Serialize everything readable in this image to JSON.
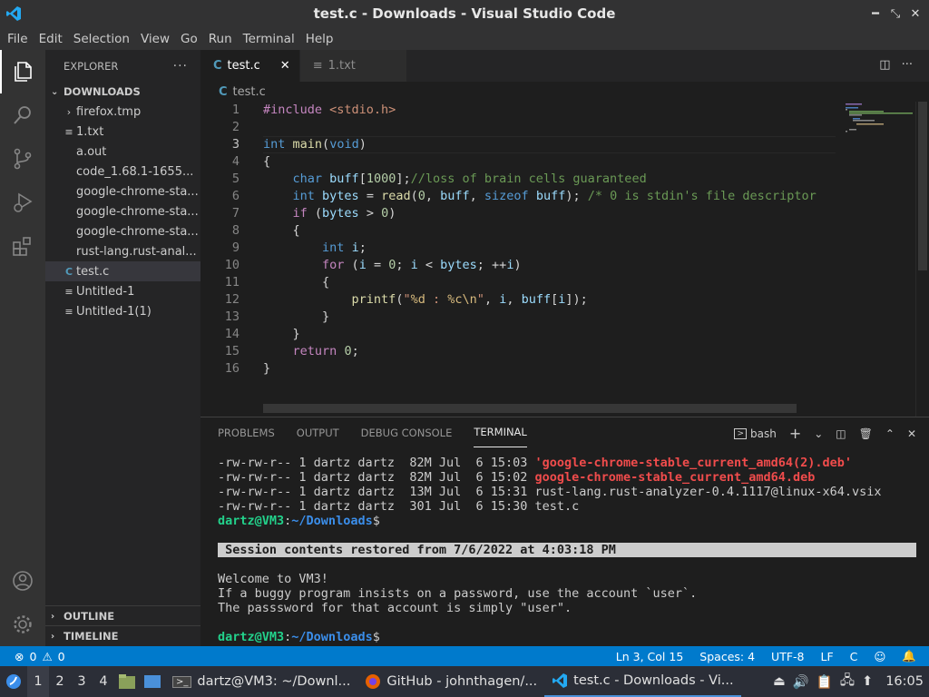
{
  "window": {
    "title": "test.c - Downloads - Visual Studio Code"
  },
  "menu": [
    "File",
    "Edit",
    "Selection",
    "View",
    "Go",
    "Run",
    "Terminal",
    "Help"
  ],
  "explorer": {
    "title": "EXPLORER",
    "folder": "DOWNLOADS",
    "items": [
      "firefox.tmp",
      "1.txt",
      "a.out",
      "code_1.68.1-1655...",
      "google-chrome-sta...",
      "google-chrome-sta...",
      "google-chrome-sta...",
      "rust-lang.rust-anal...",
      "test.c",
      "Untitled-1",
      "Untitled-1(1)"
    ],
    "outline": "OUTLINE",
    "timeline": "TIMELINE"
  },
  "tabs": [
    {
      "label": "test.c"
    },
    {
      "label": "1.txt"
    }
  ],
  "breadcrumb": "test.c",
  "line_numbers": [
    "1",
    "2",
    "3",
    "4",
    "5",
    "6",
    "7",
    "8",
    "9",
    "10",
    "11",
    "12",
    "13",
    "14",
    "15",
    "16"
  ],
  "code_lines": [
    "#include <stdio.h>",
    "",
    "int main(void)",
    "{",
    "    char buff[1000];//loss of brain cells guaranteed",
    "    int bytes = read(0, buff, sizeof buff); /* 0 is stdin's file descriptor",
    "    if (bytes > 0)",
    "    {",
    "        int i;",
    "        for (i = 0; i < bytes; ++i)",
    "        {",
    "            printf(\"%d : %c\\n\", i, buff[i]);",
    "        }",
    "    }",
    "    return 0;",
    "}"
  ],
  "panel": {
    "tabs": [
      "PROBLEMS",
      "OUTPUT",
      "DEBUG CONSOLE",
      "TERMINAL"
    ],
    "shell": "bash"
  },
  "terminal": {
    "files": [
      {
        "perm": "-rw-rw-r-- 1 dartz dartz  82M Jul  6 15:03 ",
        "name": "'google-chrome-stable_current_amd64(2).deb'",
        "color": "red"
      },
      {
        "perm": "-rw-rw-r-- 1 dartz dartz  82M Jul  6 15:02 ",
        "name": "google-chrome-stable_current_amd64.deb",
        "color": "red"
      },
      {
        "perm": "-rw-rw-r-- 1 dartz dartz  13M Jul  6 15:31 ",
        "name": "rust-lang.rust-analyzer-0.4.1117@linux-x64.vsix",
        "color": "plain"
      },
      {
        "perm": "-rw-rw-r-- 1 dartz dartz  301 Jul  6 15:30 ",
        "name": "test.c",
        "color": "plain"
      }
    ],
    "prompt_user": "dartz@VM3",
    "prompt_path": "~/Downloads",
    "prompt_sym": "$",
    "banner": " Session contents restored from 7/6/2022 at 4:03:18 PM",
    "welcome": [
      "Welcome to VM3!",
      "If a buggy program insists on a password, use the account `user`.",
      "The passsword for that account is simply \"user\"."
    ]
  },
  "status": {
    "errors": "0",
    "warnings": "0",
    "position": "Ln 3, Col 15",
    "spaces": "Spaces: 4",
    "encoding": "UTF-8",
    "eol": "LF",
    "language": "C"
  },
  "taskbar": {
    "workspaces": [
      "1",
      "2",
      "3",
      "4"
    ],
    "apps": [
      "dartz@VM3: ~/Downl...",
      "GitHub - johnthagen/...",
      "test.c - Downloads - Vi..."
    ],
    "clock": "16:05"
  },
  "colors": {
    "accent": "#007acc",
    "activity": "#333333",
    "sidebar": "#252526",
    "editor": "#1e1e1e"
  }
}
